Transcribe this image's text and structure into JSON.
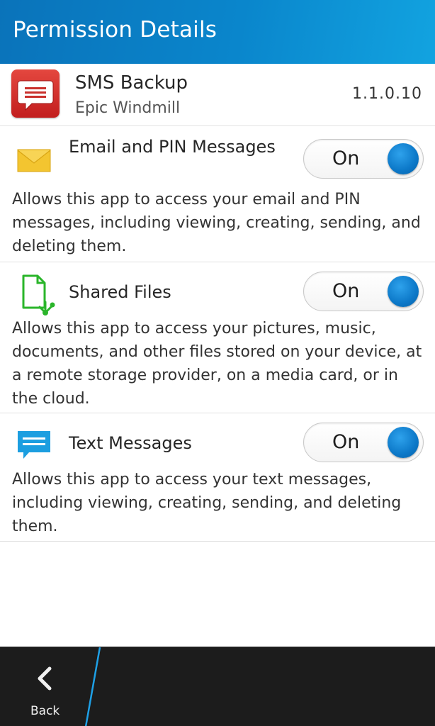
{
  "title_bar": {
    "title": "Permission Details"
  },
  "app": {
    "name": "SMS Backup",
    "developer": "Epic Windmill",
    "version": "1.1.0.10",
    "icon": "sms-app-icon"
  },
  "permissions": [
    {
      "title": "Email and PIN Messages",
      "icon": "envelope-icon",
      "toggle_label": "On",
      "toggle_state": true,
      "description": "Allows this app to access your email and PIN messages, including viewing, creating, sending, and deleting them."
    },
    {
      "title": "Shared Files",
      "icon": "shared-file-icon",
      "toggle_label": "On",
      "toggle_state": true,
      "description": "Allows this app to access your pictures, music, documents, and other files stored on your device, at a remote storage provider, on a media card, or in the cloud."
    },
    {
      "title": "Text Messages",
      "icon": "speech-bubble-icon",
      "toggle_label": "On",
      "toggle_state": true,
      "description": "Allows this app to access your text messages, including viewing, creating, sending, and deleting them."
    }
  ],
  "action_bar": {
    "back_label": "Back"
  },
  "colors": {
    "title_bar": "#0a86cc",
    "toggle_knob": "#0c78c8",
    "action_bar": "#1c1c1c",
    "accent_divider": "#1ea0e6"
  }
}
